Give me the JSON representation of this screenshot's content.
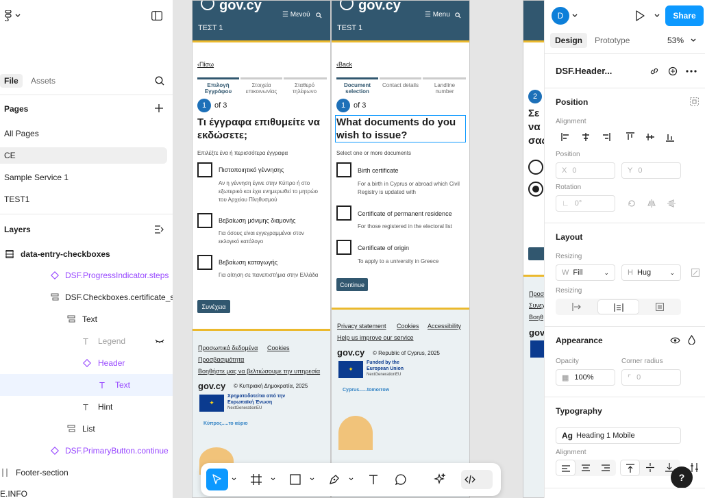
{
  "left_panel": {
    "tabs": {
      "file": "File",
      "assets": "Assets"
    },
    "pages_title": "Pages",
    "pages": [
      "All Pages",
      "CE",
      "Sample Service 1",
      "TEST1"
    ],
    "layers_title": "Layers",
    "layers": [
      {
        "label": "data-entry-checkboxes"
      },
      {
        "label": "DSF.ProgressIndicator.steps"
      },
      {
        "label": "DSF.Checkboxes.certificate_se"
      },
      {
        "label": "Text"
      },
      {
        "label": "Legend"
      },
      {
        "label": "Header"
      },
      {
        "label": "Text"
      },
      {
        "label": "Hint"
      },
      {
        "label": "List"
      },
      {
        "label": "DSF.PrimaryButton.continue"
      },
      {
        "label": "Footer-section"
      },
      {
        "label": "E.INFO"
      }
    ]
  },
  "greek_frame": {
    "logo": "gov.cy",
    "menu": "Μενού",
    "service": "ΤΕΣΤ 1",
    "back": "Πίσω",
    "steps": [
      "Επιλογή Εγγράφου",
      "Στοιχεία επικοινωνίας",
      "Σταθερό τηλέφωνο"
    ],
    "step_num": "1",
    "step_of": "of 3",
    "heading": "Τι έγγραφα επιθυμείτε να εκδώσετε;",
    "hint": "Επιλέξτε ένα ή περισσότερα έγγραφα",
    "options": [
      {
        "label": "Πιστοποιητικό γέννησης",
        "hint": "Αν η γέννηση έγινε στην Κύπρο ή στο εξωτερικό και έχει ενημερωθεί το μητρώο του Αρχείου Πληθυσμού"
      },
      {
        "label": "Βεβαίωση μόνιμης διαμονής",
        "hint": "Για όσους είναι εγγεγραμμένοι στον εκλογικό κατάλογο"
      },
      {
        "label": "Βεβαίωση καταγωγής",
        "hint": "Για αίτηση σε πανεπιστήμια στην Ελλάδα"
      }
    ],
    "button": "Συνέχεια",
    "footer_links": [
      "Προσωπικά δεδομένα",
      "Cookies",
      "Προσβασιμότητα",
      "Βοηθήστε μας να βελτιώσουμε την υπηρεσία"
    ],
    "footer_logo": "gov.cy",
    "copyright": "© Κυπριακή Δημοκρατία, 2025",
    "eu_text": "Χρηματοδοτείται από την Ευρωπαϊκή Ένωση",
    "eu_sub": "NextGenerationEU",
    "tomorrow": "Κύπρος.....το αύριο"
  },
  "english_frame": {
    "logo": "gov.cy",
    "menu": "Menu",
    "service": "TEST 1",
    "back": "Back",
    "steps": [
      "Document selection",
      "Contact details",
      "Landline number"
    ],
    "step_num": "1",
    "step_of": "of 3",
    "heading": "What documents do you wish to issue?",
    "hint": "Select one or more documents",
    "options": [
      {
        "label": "Birth certificate",
        "hint": "For a birth in Cyprus or abroad which Civil Registry is updated with"
      },
      {
        "label": "Certificate of permanent residence",
        "hint": "For those registered in the electoral list"
      },
      {
        "label": "Certificate of origin",
        "hint": "To apply to a university in Greece"
      }
    ],
    "button": "Continue",
    "footer_links": [
      "Privacy statement",
      "Cookies",
      "Accessibility",
      "Help us improve our service"
    ],
    "footer_logo": "gov.cy",
    "copyright": "© Republic of Cyprus, 2025",
    "eu_text": "Funded by the European Union",
    "eu_sub": "NextGenerationEU",
    "tomorrow": "Cyprus......tomorrow"
  },
  "third_frame": {
    "step_num": "2",
    "heading": "Σε να σας",
    "footer_frag": [
      "Προσ",
      "Συνεχ",
      "Βοηθ",
      "gov"
    ]
  },
  "right_panel": {
    "avatar": "D",
    "share": "Share",
    "tabs": {
      "design": "Design",
      "prototype": "Prototype"
    },
    "zoom": "53%",
    "layer_name": "DSF.Header...",
    "position": {
      "title": "Position",
      "alignment": "Alignment",
      "position_label": "Position",
      "x_label": "X",
      "x": "0",
      "y_label": "Y",
      "y": "0",
      "rotation_label": "Rotation",
      "rotation": "0°"
    },
    "layout": {
      "title": "Layout",
      "resizing": "Resizing",
      "w_label": "W",
      "w": "Fill",
      "h_label": "H",
      "h": "Hug",
      "resizing2": "Resizing"
    },
    "appearance": {
      "title": "Appearance",
      "opacity_label": "Opacity",
      "opacity": "100%",
      "radius_label": "Corner radius",
      "radius": "0"
    },
    "typography": {
      "title": "Typography",
      "style_prefix": "Ag",
      "style": "Heading 1 Mobile",
      "alignment": "Alignment"
    },
    "help": "?"
  }
}
